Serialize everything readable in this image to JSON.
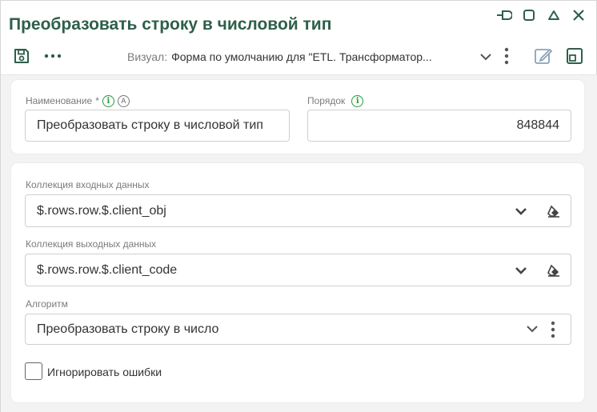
{
  "window": {
    "title": "Преобразовать строку в числовой тип",
    "controls": [
      "pin-icon",
      "maximize-icon",
      "collapse-icon",
      "close-icon"
    ]
  },
  "toolbar": {
    "save_icon": "floppy-disk-icon",
    "more_icon": "ellipsis-icon",
    "visual_label": "Визуал:",
    "visual_value": "Форма по умолчанию для \"ETL. Трансформатор...",
    "edit_icon": "pencil-square-icon",
    "window_icon": "window-restore-icon"
  },
  "fields": {
    "name": {
      "label": "Наименование",
      "required_mark": "*",
      "auto_badge": "A",
      "value": "Преобразовать строку в числовой тип"
    },
    "order": {
      "label": "Порядок",
      "value": "848844"
    },
    "input_collection": {
      "label": "Коллекция входных данных",
      "value": "$.rows.row.$.client_obj"
    },
    "output_collection": {
      "label": "Коллекция выходных данных",
      "value": "$.rows.row.$.client_code"
    },
    "algorithm": {
      "label": "Алгоритм",
      "value": "Преобразовать строку в число"
    },
    "ignore_errors": {
      "label": "Игнорировать ошибки",
      "checked": false
    }
  },
  "colors": {
    "title": "#2e5f4a",
    "info": "#1f9a3a",
    "accent_icon": "#2e5f4a",
    "background": "#f3f3f3"
  }
}
